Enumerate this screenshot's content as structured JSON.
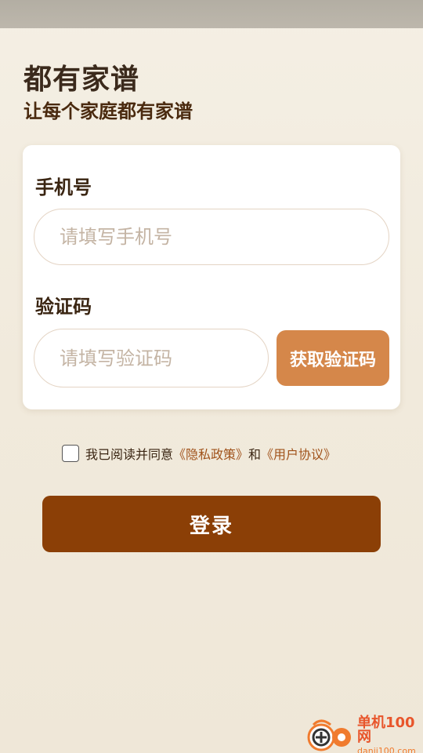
{
  "app": {
    "title": "都有家谱",
    "subtitle": "让每个家庭都有家谱"
  },
  "form": {
    "phone_label": "手机号",
    "phone_placeholder": "请填写手机号",
    "phone_value": "",
    "code_label": "验证码",
    "code_placeholder": "请填写验证码",
    "code_value": "",
    "get_code_label": "获取验证码"
  },
  "agreement": {
    "checked": false,
    "prefix": "我已阅读并同意",
    "privacy_link": "《隐私政策》",
    "conjunction": "和",
    "terms_link": "《用户协议》"
  },
  "login_label": "登录",
  "watermark": {
    "logo_icon": "danji-logo-icon",
    "text_cn": "单机100网",
    "text_en": "danji100.com"
  },
  "colors": {
    "background": "#f2ecdf",
    "get_code_button": "#d5874a",
    "login_button": "#8b3f06",
    "link": "#a0521a"
  }
}
